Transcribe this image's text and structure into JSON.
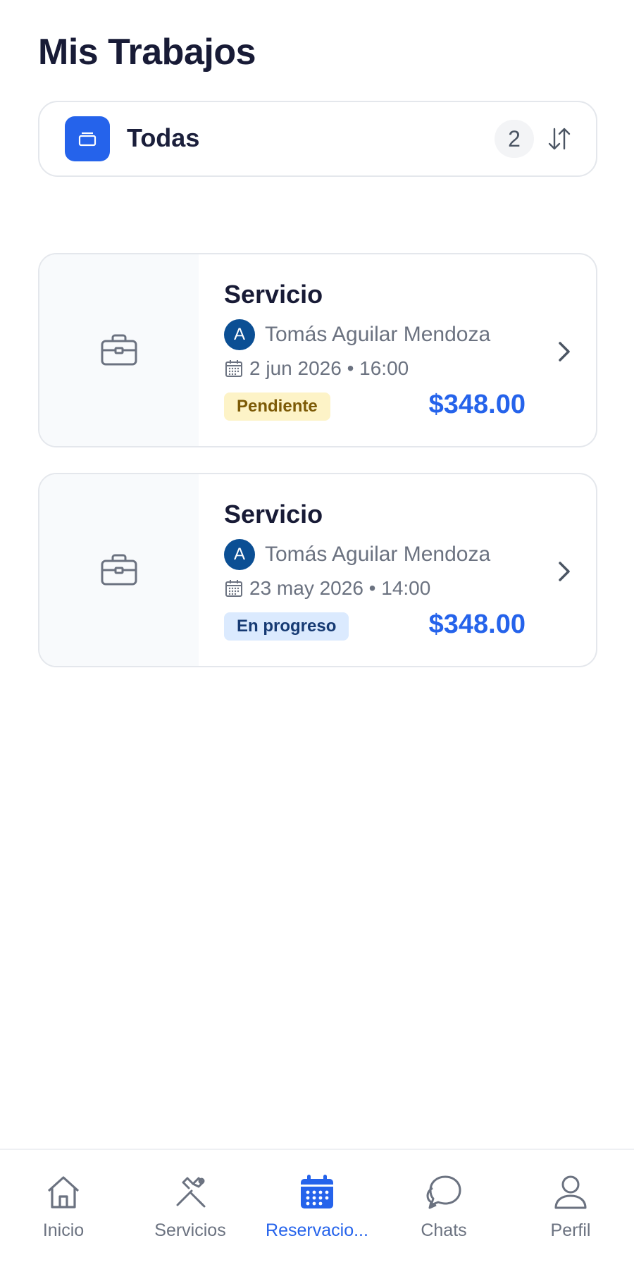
{
  "header": {
    "title": "Mis Trabajos"
  },
  "filter": {
    "label": "Todas",
    "count": "2",
    "accent": "#2563eb",
    "icon": "stack-icon",
    "sort_icon": "sort-arrows-icon"
  },
  "jobs": [
    {
      "title": "Servicio",
      "client_initial": "A",
      "client_name": "Tomás Aguilar Mendoza",
      "date": "2 jun 2026 • 16:00",
      "status": "Pendiente",
      "status_color": "#fdf3c7",
      "price": "$348.00"
    },
    {
      "title": "Servicio",
      "client_initial": "A",
      "client_name": "Tomás Aguilar Mendoza",
      "date": "23 may 2026 • 14:00",
      "status": "En progreso",
      "status_color": "#dbeafe",
      "price": "$348.00"
    }
  ],
  "nav": {
    "items": [
      {
        "label": "Inicio",
        "icon": "home-icon"
      },
      {
        "label": "Servicios",
        "icon": "tools-icon"
      },
      {
        "label": "Reservacio...",
        "icon": "calendar-icon",
        "active": true
      },
      {
        "label": "Chats",
        "icon": "chat-icon"
      },
      {
        "label": "Perfil",
        "icon": "user-icon"
      }
    ],
    "active_color": "#2563eb"
  }
}
